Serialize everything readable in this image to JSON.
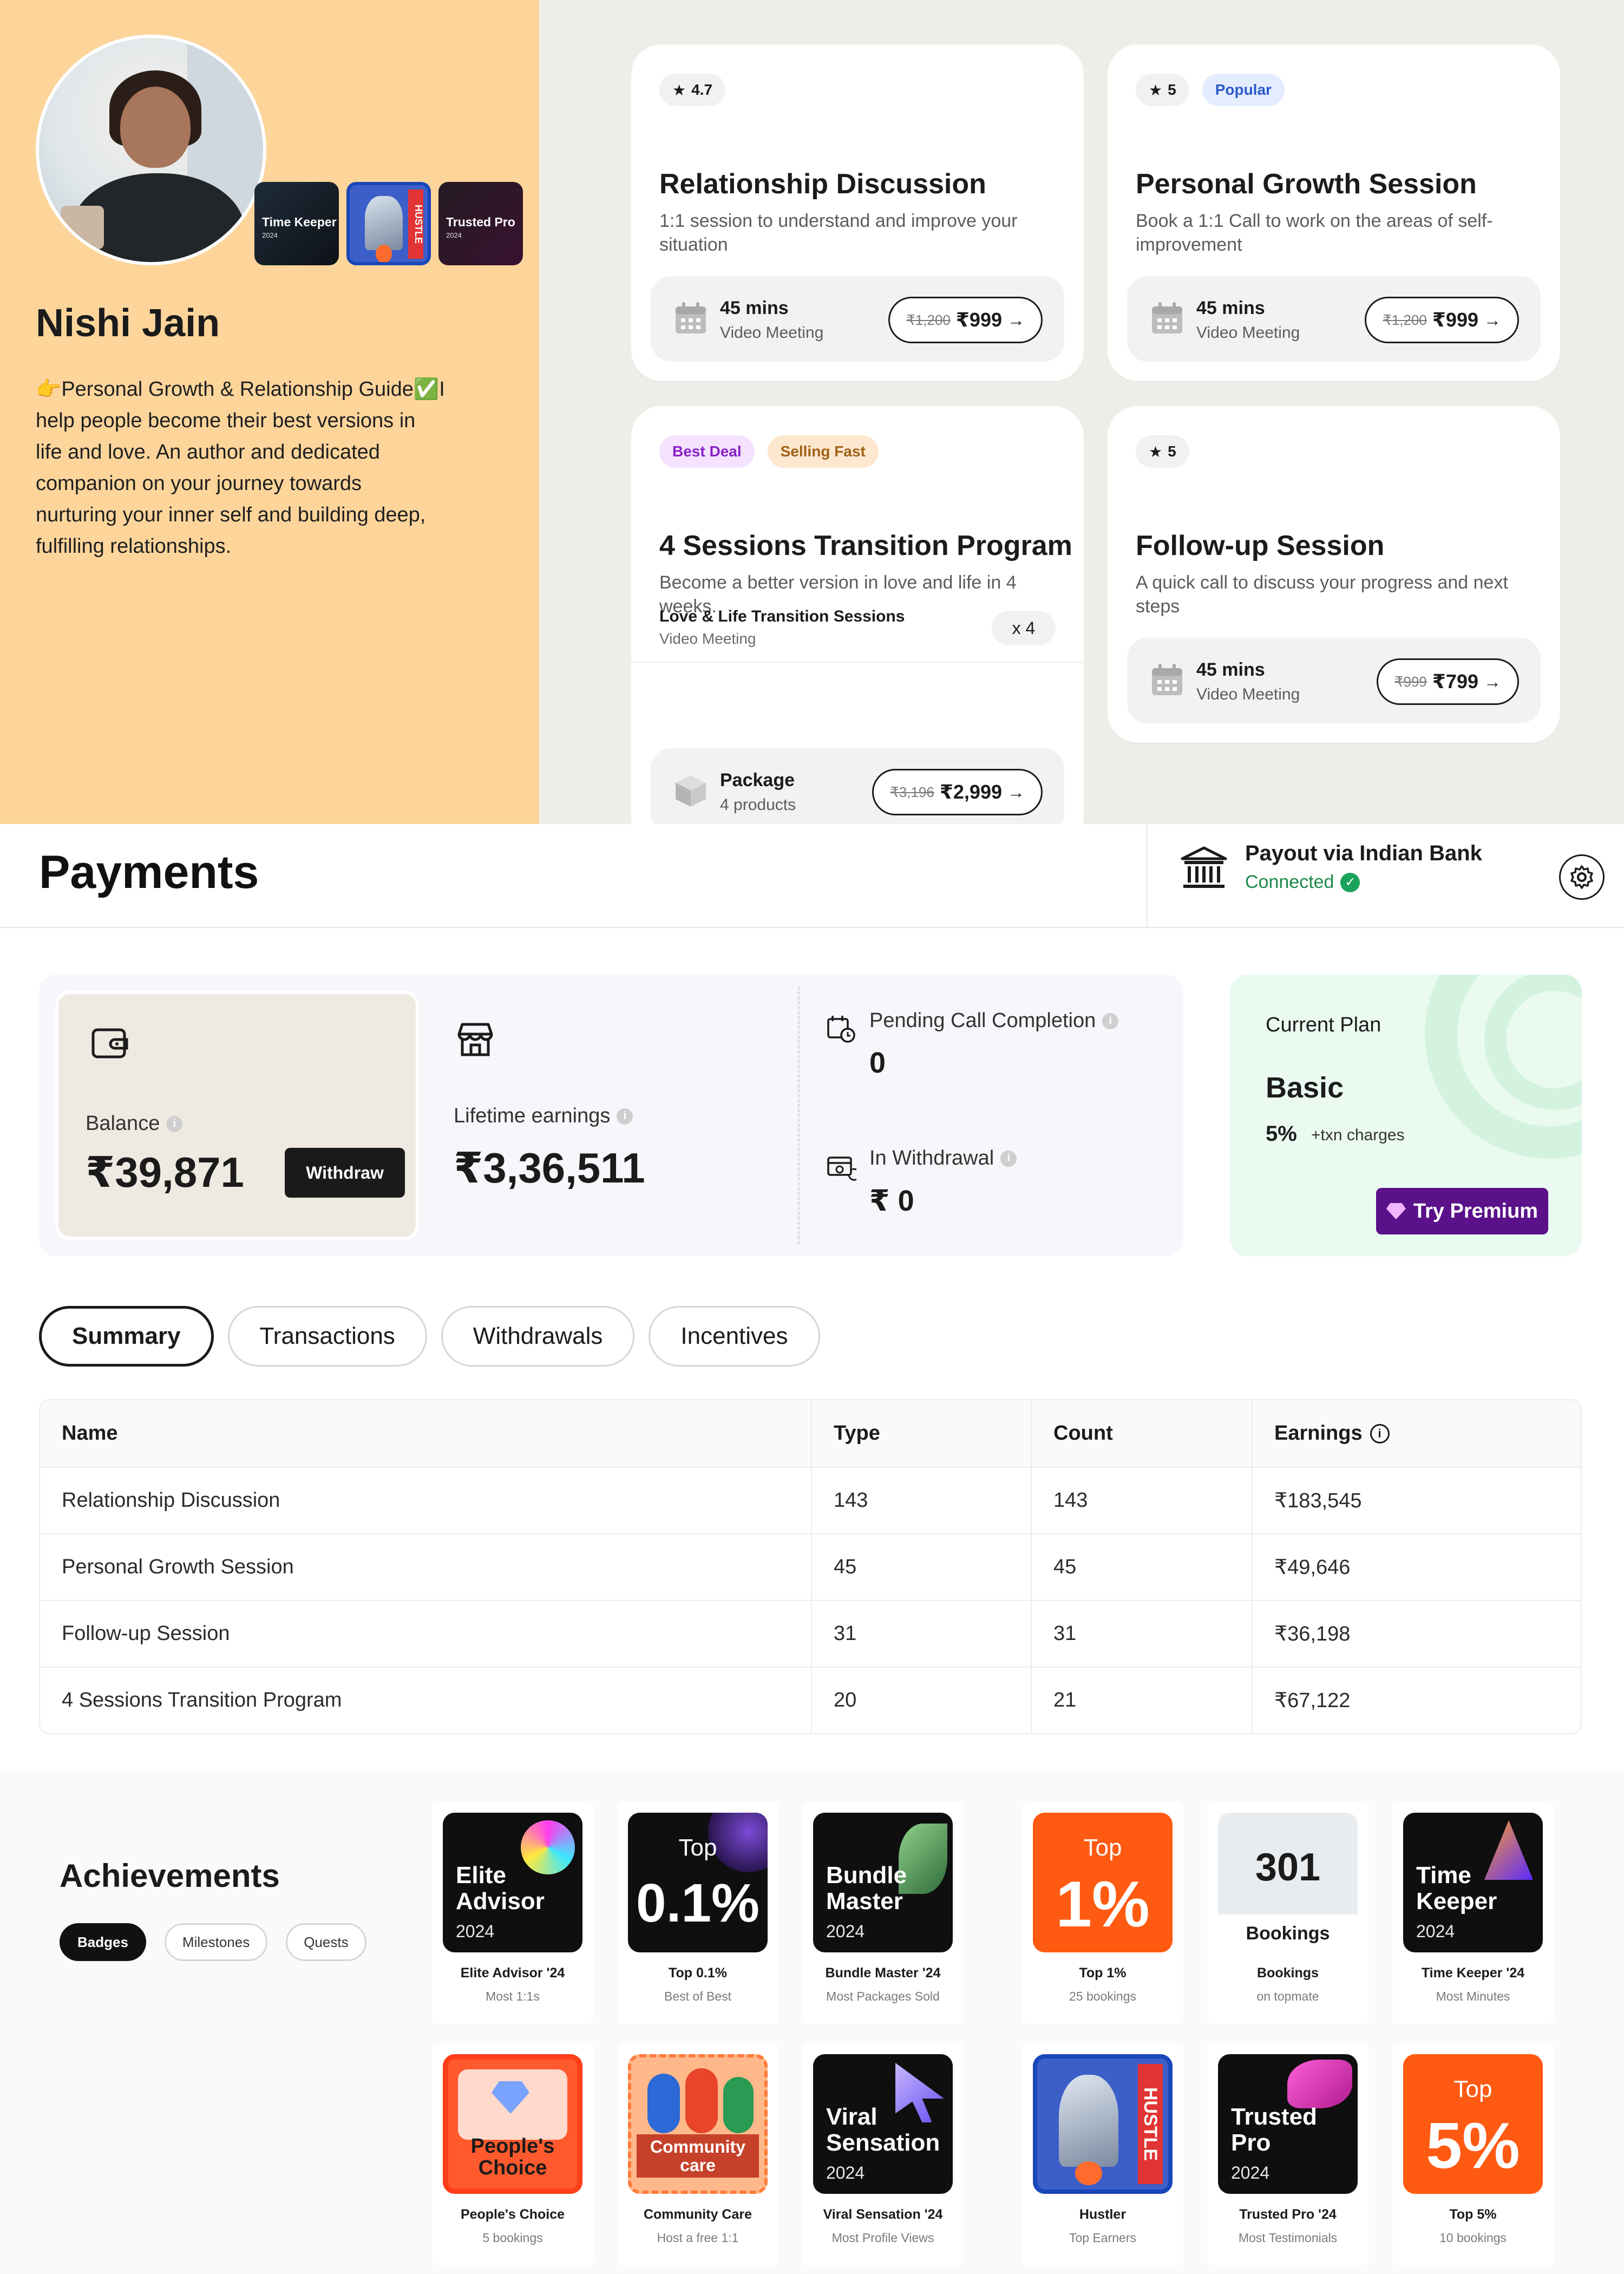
{
  "profile": {
    "name": "Nishi Jain",
    "bio": "👉Personal Growth & Relationship Guide✅I help people become their best versions in life and love. An author and dedicated companion on your journey towards nurturing your inner self and building deep, fulfilling relationships.",
    "mini_badges": [
      {
        "title": "Time Keeper",
        "year": "2024"
      },
      {
        "title": "HUSTLE",
        "year": ""
      },
      {
        "title": "Trusted Pro",
        "year": "2024"
      }
    ]
  },
  "services": [
    {
      "rating": "4.7",
      "tags": [],
      "title": "Relationship Discussion",
      "desc": "1:1 session to understand and improve your situation",
      "duration": "45 mins",
      "mode": "Video Meeting",
      "old_price": "₹1,200",
      "price": "₹999"
    },
    {
      "rating": "5",
      "tags": [
        "Popular"
      ],
      "title": "Personal Growth Session",
      "desc": "Book a 1:1 Call to work on the areas of self-improvement",
      "duration": "45 mins",
      "mode": "Video Meeting",
      "old_price": "₹1,200",
      "price": "₹999"
    },
    {
      "tags": [
        "Best Deal",
        "Selling Fast"
      ],
      "title": "4 Sessions Transition Program",
      "desc": "Become a better version in love and life in 4 weeks.",
      "item_name": "Love & Life Transition Sessions",
      "item_mode": "Video Meeting",
      "item_qty": "x 4",
      "package_label": "Package",
      "package_count": "4 products",
      "old_price": "₹3,196",
      "price": "₹2,999"
    },
    {
      "rating": "5",
      "tags": [],
      "title": "Follow-up Session",
      "desc": "A quick call to discuss your progress and next steps",
      "duration": "45 mins",
      "mode": "Video Meeting",
      "old_price": "₹999",
      "price": "₹799"
    }
  ],
  "payments": {
    "title": "Payments",
    "payout_title": "Payout via Indian Bank",
    "payout_status": "Connected",
    "balance_label": "Balance",
    "balance_value": "₹39,871",
    "withdraw_label": "Withdraw",
    "lifetime_label": "Lifetime earnings",
    "lifetime_value": "₹3,36,511",
    "pending_label": "Pending Call Completion",
    "pending_value": "0",
    "inwithdrawal_label": "In Withdrawal",
    "inwithdrawal_value": "₹ 0",
    "plan_label": "Current Plan",
    "plan_name": "Basic",
    "plan_pct": "5%",
    "plan_charges": "+txn charges",
    "premium_label": "Try Premium"
  },
  "tabs": [
    "Summary",
    "Transactions",
    "Withdrawals",
    "Incentives"
  ],
  "table": {
    "headers": [
      "Name",
      "Type",
      "Count",
      "Earnings"
    ],
    "rows": [
      [
        "Relationship Discussion",
        "143",
        "143",
        "₹183,545"
      ],
      [
        "Personal Growth Session",
        "45",
        "45",
        "₹49,646"
      ],
      [
        "Follow-up Session",
        "31",
        "31",
        "₹36,198"
      ],
      [
        "4 Sessions Transition Program",
        "20",
        "21",
        "₹67,122"
      ]
    ]
  },
  "achievements": {
    "title": "Achievements",
    "tabs": [
      "Badges",
      "Milestones",
      "Quests"
    ],
    "badges": [
      {
        "img_title": "Elite Advisor",
        "img_year": "2024",
        "label": "Elite Advisor '24",
        "sub": "Most 1:1s"
      },
      {
        "img_top": "Top",
        "img_big": "0.1%",
        "label": "Top 0.1%",
        "sub": "Best of Best"
      },
      {
        "img_title": "Bundle Master",
        "img_year": "2024",
        "label": "Bundle Master '24",
        "sub": "Most Packages Sold"
      },
      {
        "img_top": "Top",
        "img_big": "1%",
        "label": "Top 1%",
        "sub": "25 bookings"
      },
      {
        "img_big": "301",
        "img_cap": "Bookings",
        "label": "Bookings",
        "sub": "on topmate"
      },
      {
        "img_title": "Time Keeper",
        "img_year": "2024",
        "label": "Time Keeper '24",
        "sub": "Most Minutes"
      },
      {
        "img_title": "People's Choice",
        "label": "People's Choice",
        "sub": "5 bookings"
      },
      {
        "img_title": "Community care",
        "label": "Community Care",
        "sub": "Host a free 1:1"
      },
      {
        "img_title": "Viral Sensation",
        "img_year": "2024",
        "label": "Viral Sensation '24",
        "sub": "Most Profile Views"
      },
      {
        "img_title": "HUSTLE",
        "label": "Hustler",
        "sub": "Top Earners"
      },
      {
        "img_title": "Trusted Pro",
        "img_year": "2024",
        "label": "Trusted Pro '24",
        "sub": "Most Testimonials"
      },
      {
        "img_top": "Top",
        "img_big": "5%",
        "label": "Top 5%",
        "sub": "10 bookings"
      }
    ]
  }
}
